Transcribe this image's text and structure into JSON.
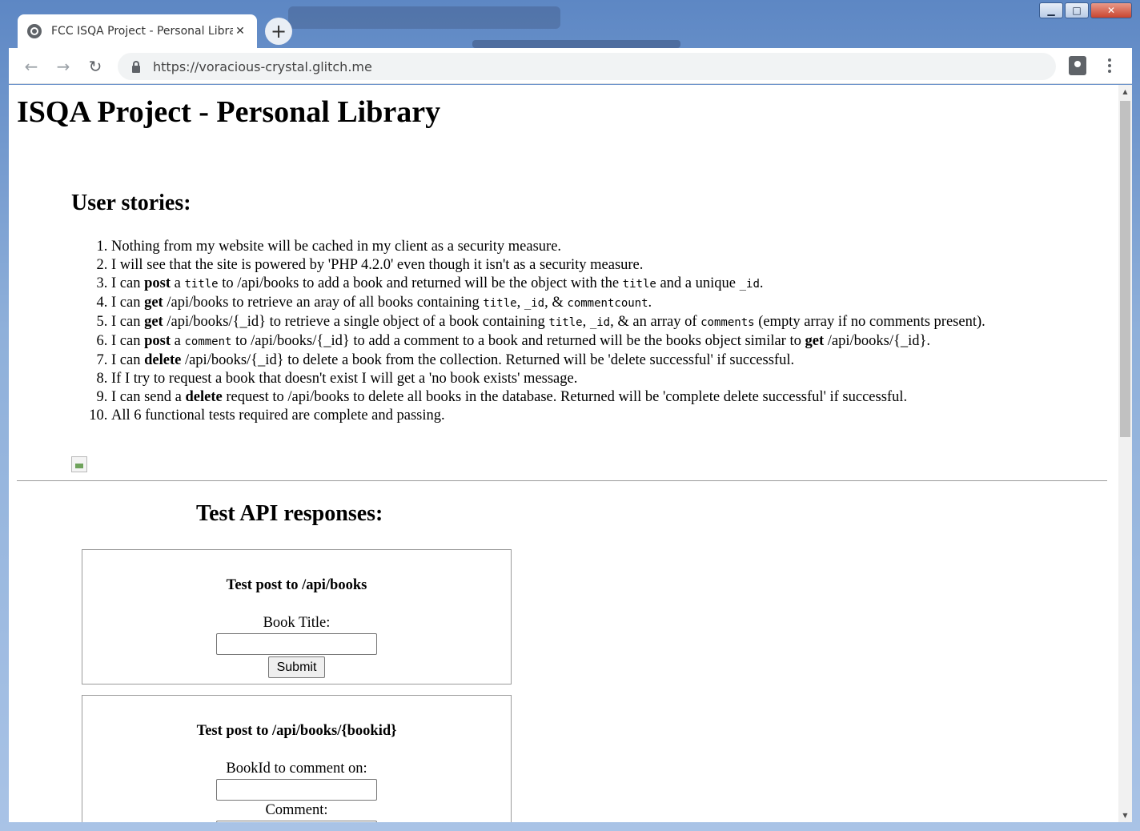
{
  "browser": {
    "tab_title": "FCC ISQA Project - Personal Libra",
    "url": "https://voracious-crystal.glitch.me"
  },
  "page": {
    "title": "ISQA Project - Personal Library",
    "stories_heading": "User stories:",
    "stories": [
      {
        "parts": [
          {
            "t": "Nothing from my website will be cached in my client as a security measure."
          }
        ]
      },
      {
        "parts": [
          {
            "t": "I will see that the site is powered by 'PHP 4.2.0' even though it isn't as a security measure."
          }
        ]
      },
      {
        "parts": [
          {
            "t": "I can "
          },
          {
            "t": "post",
            "b": true
          },
          {
            "t": " a "
          },
          {
            "t": "title",
            "c": true
          },
          {
            "t": " to /api/books to add a book and returned will be the object with the "
          },
          {
            "t": "title",
            "c": true
          },
          {
            "t": " and a unique "
          },
          {
            "t": "_id",
            "c": true
          },
          {
            "t": "."
          }
        ]
      },
      {
        "parts": [
          {
            "t": "I can "
          },
          {
            "t": "get",
            "b": true
          },
          {
            "t": " /api/books to retrieve an aray of all books containing "
          },
          {
            "t": "title",
            "c": true
          },
          {
            "t": ", "
          },
          {
            "t": "_id",
            "c": true
          },
          {
            "t": ", & "
          },
          {
            "t": "commentcount",
            "c": true
          },
          {
            "t": "."
          }
        ]
      },
      {
        "parts": [
          {
            "t": "I can "
          },
          {
            "t": "get",
            "b": true
          },
          {
            "t": " /api/books/{_id} to retrieve a single object of a book containing "
          },
          {
            "t": "title",
            "c": true
          },
          {
            "t": ", "
          },
          {
            "t": "_id",
            "c": true
          },
          {
            "t": ", & an array of "
          },
          {
            "t": "comments",
            "c": true
          },
          {
            "t": " (empty array if no comments present)."
          }
        ]
      },
      {
        "parts": [
          {
            "t": "I can "
          },
          {
            "t": "post",
            "b": true
          },
          {
            "t": " a "
          },
          {
            "t": "comment",
            "c": true
          },
          {
            "t": " to /api/books/{_id} to add a comment to a book and returned will be the books object similar to "
          },
          {
            "t": "get",
            "b": true
          },
          {
            "t": " /api/books/{_id}."
          }
        ]
      },
      {
        "parts": [
          {
            "t": "I can "
          },
          {
            "t": "delete",
            "b": true
          },
          {
            "t": " /api/books/{_id} to delete a book from the collection. Returned will be 'delete successful' if successful."
          }
        ]
      },
      {
        "parts": [
          {
            "t": "If I try to request a book that doesn't exist I will get a 'no book exists' message."
          }
        ]
      },
      {
        "parts": [
          {
            "t": "I can send a "
          },
          {
            "t": "delete",
            "b": true
          },
          {
            "t": " request to /api/books to delete all books in the database. Returned will be 'complete delete successful' if successful."
          }
        ]
      },
      {
        "parts": [
          {
            "t": "All 6 functional tests required are complete and passing."
          }
        ]
      }
    ],
    "test_heading": "Test API responses:",
    "form1": {
      "title": "Test post to /api/books",
      "label": "Book Title:",
      "value": "",
      "submit_label": "Submit"
    },
    "form2": {
      "title": "Test post to /api/books/{bookid}",
      "label": "BookId to comment on:",
      "value": "",
      "comment_label": "Comment:",
      "comment_value": ""
    }
  }
}
